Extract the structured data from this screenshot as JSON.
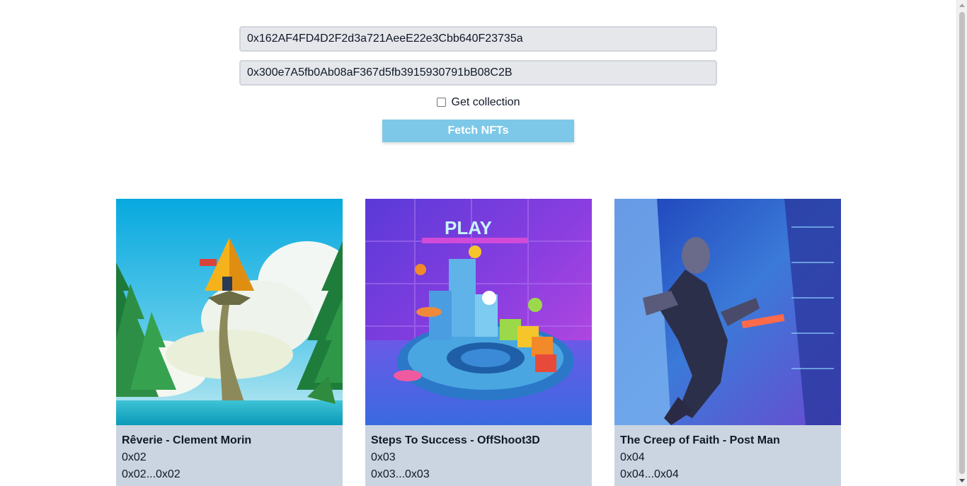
{
  "form": {
    "wallet_address": "0x162AF4FD4D2F2d3a721AeeE22e3Cbb640F23735a",
    "collection_address": "0x300e7A5fb0Ab08aF367d5fb3915930791bB08C2B",
    "get_collection_label": "Get collection",
    "get_collection_checked": false,
    "fetch_button_label": "Fetch NFTs"
  },
  "nfts": [
    {
      "title": "Rêverie - Clement Morin",
      "token_id": "0x02",
      "token_range": "0x02...0x02",
      "image_icon": "treehouse-artwork"
    },
    {
      "title": "Steps To Success - OffShoot3D",
      "token_id": "0x03",
      "token_range": "0x03...0x03",
      "image_icon": "play-stage-artwork"
    },
    {
      "title": "The Creep of Faith - Post Man",
      "token_id": "0x04",
      "token_range": "0x04...0x04",
      "image_icon": "climbing-man-artwork"
    }
  ],
  "colors": {
    "button": "#7dc8e8",
    "card_background": "#cbd5e1",
    "input_background": "#e5e7eb"
  }
}
